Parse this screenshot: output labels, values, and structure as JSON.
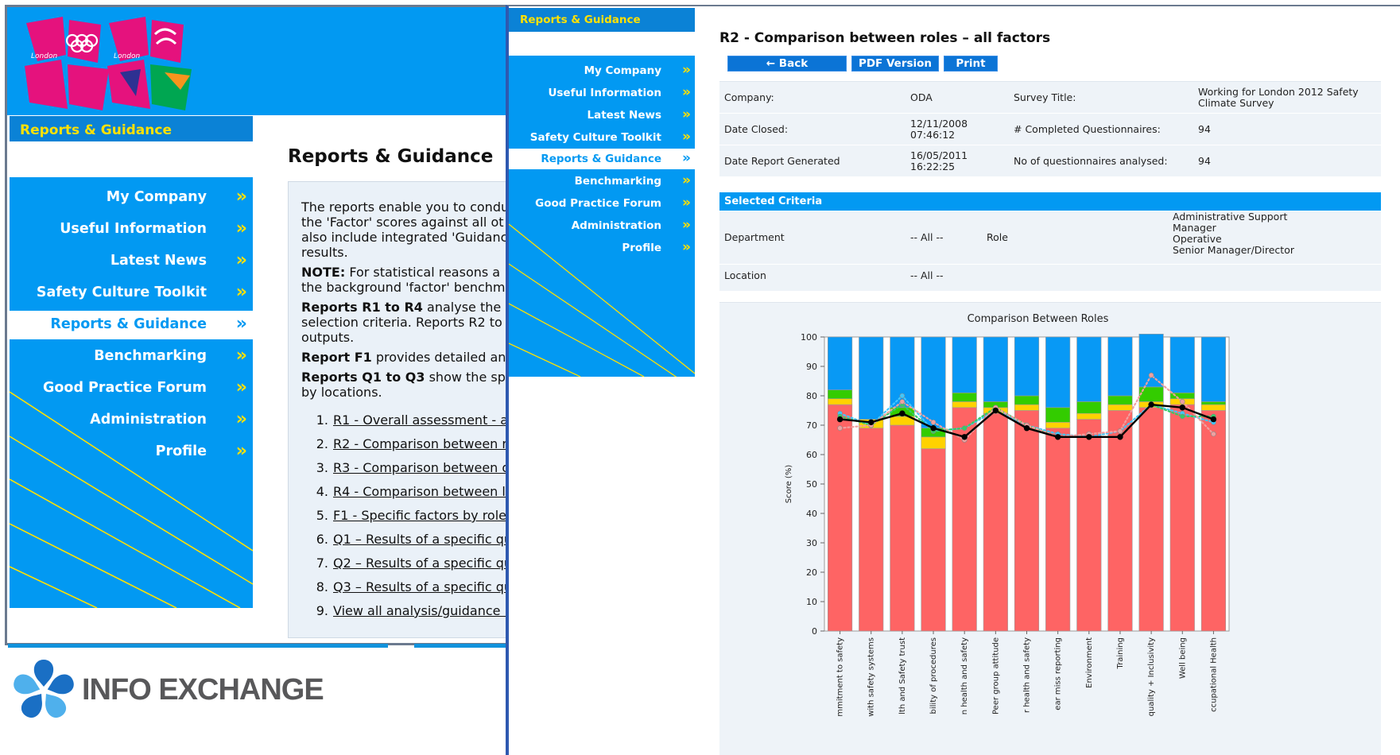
{
  "back_window": {
    "header_label": "Reports & Guidance",
    "nav": [
      {
        "label": "My Company",
        "active": false
      },
      {
        "label": "Useful Information",
        "active": false
      },
      {
        "label": "Latest News",
        "active": false
      },
      {
        "label": "Safety Culture Toolkit",
        "active": false
      },
      {
        "label": "Reports & Guidance",
        "active": true
      },
      {
        "label": "Benchmarking",
        "active": false
      },
      {
        "label": "Good Practice Forum",
        "active": false
      },
      {
        "label": "Administration",
        "active": false
      },
      {
        "label": "Profile",
        "active": false
      }
    ],
    "chevron": "»",
    "page_title": "Reports & Guidance",
    "paragraphs": [
      [
        "The reports enable you to condu",
        "the 'Factor' scores against all ot",
        "also include integrated 'Guidanc",
        "results."
      ],
      [
        "NOTE:",
        " For statistical reasons a",
        "the background 'factor' benchm"
      ],
      [
        "Reports R1 to R4",
        " analyse the",
        "selection criteria. Reports R2 to",
        "outputs."
      ],
      [
        "Report F1",
        " provides detailed an"
      ],
      [
        "Reports Q1 to Q3",
        " show the sp",
        "by locations."
      ]
    ],
    "reports_list": [
      {
        "num": "1.",
        "label": "R1 - Overall assessment - a"
      },
      {
        "num": "2.",
        "label": "R2 - Comparison between r"
      },
      {
        "num": "3.",
        "label": "R3 - Comparison between d"
      },
      {
        "num": "4.",
        "label": "R4 - Comparison between lo"
      },
      {
        "num": "5.",
        "label": "F1 - Specific factors by roles"
      },
      {
        "num": "6.",
        "label": "Q1 – Results of a specific qu"
      },
      {
        "num": "7.",
        "label": "Q2 – Results of a specific qu"
      },
      {
        "num": "8.",
        "label": "Q3 – Results of a specific qu"
      },
      {
        "num": "9.",
        "label": "View all analysis/guidance n"
      }
    ],
    "logo_small_text": "London"
  },
  "footer_logo": {
    "text": "INFO EXCHANGE",
    "colors": {
      "primary": "#1a6fc4",
      "light": "#4fb0ec"
    }
  },
  "front_window": {
    "header_label": "Reports & Guidance",
    "nav": [
      {
        "label": "My Company",
        "active": false
      },
      {
        "label": "Useful Information",
        "active": false
      },
      {
        "label": "Latest News",
        "active": false
      },
      {
        "label": "Safety Culture Toolkit",
        "active": false
      },
      {
        "label": "Reports & Guidance",
        "active": true
      },
      {
        "label": "Benchmarking",
        "active": false
      },
      {
        "label": "Good Practice Forum",
        "active": false
      },
      {
        "label": "Administration",
        "active": false
      },
      {
        "label": "Profile",
        "active": false
      }
    ],
    "chevron": "»",
    "page_title": "R2 - Comparison between roles – all factors",
    "buttons": {
      "back": "← Back",
      "pdf": "PDF Version",
      "print": "Print"
    },
    "info": {
      "company_label": "Company:",
      "company_value": "ODA",
      "survey_title_label": "Survey Title:",
      "survey_title_value_1": "Working for London 2012 Safety",
      "survey_title_value_2": "Climate Survey",
      "date_closed_label": "Date Closed:",
      "date_closed_value_1": "12/11/2008",
      "date_closed_value_2": "07:46:12",
      "completed_label": "# Completed Questionnaires:",
      "completed_value": "94",
      "generated_label": "Date Report Generated",
      "generated_value_1": "16/05/2011",
      "generated_value_2": "16:22:25",
      "analysed_label": "No of questionnaires analysed:",
      "analysed_value": "94"
    },
    "criteria": {
      "heading": "Selected Criteria",
      "department_label": "Department",
      "department_value": "-- All --",
      "role_label": "Role",
      "roles": [
        "Administrative Support",
        "Manager",
        "Operative",
        "Senior Manager/Director"
      ],
      "location_label": "Location",
      "location_value": "-- All --"
    }
  },
  "chart_data": {
    "type": "bar",
    "title": "Comparison Between Roles",
    "ylabel": "Score (%)",
    "xlabel": "",
    "ylim": [
      0,
      100
    ],
    "yticks": [
      0,
      10,
      20,
      30,
      40,
      50,
      60,
      70,
      80,
      90,
      100
    ],
    "grid": false,
    "categories": [
      "mmitment to safety",
      "with safety systems",
      "lth and Safety trust",
      "bility of procedures",
      "n health and safety",
      "Peer group attitude",
      "r health and safety",
      "ear miss reporting",
      "Environment",
      "Training",
      "quality + Inclusivity",
      "Well being",
      "ccupational Health"
    ],
    "stacked_series": [
      {
        "color": "#fe6464",
        "values": [
          77,
          69,
          70,
          62,
          76,
          74,
          75,
          69,
          72,
          75,
          76,
          77,
          75
        ]
      },
      {
        "color": "#ffd200",
        "values": [
          2,
          3,
          3,
          4,
          2,
          2,
          2,
          2,
          2,
          2,
          2,
          2,
          2
        ]
      },
      {
        "color": "#33cc00",
        "values": [
          3,
          0,
          3,
          3,
          3,
          2,
          3,
          5,
          4,
          3,
          5,
          2,
          1
        ]
      },
      {
        "color": "#0899f5",
        "values": [
          18,
          28,
          24,
          31,
          19,
          22,
          20,
          24,
          22,
          20,
          18,
          19,
          22
        ]
      }
    ],
    "line_series": [
      {
        "color": "#000000",
        "values": [
          72,
          71,
          74,
          69,
          66,
          75,
          69,
          66,
          66,
          66,
          77,
          76,
          72
        ]
      },
      {
        "color": "#40c8ff",
        "values": [
          74,
          70,
          80,
          68,
          69,
          75,
          70,
          67,
          66,
          68,
          77,
          74,
          71
        ]
      },
      {
        "color": "#33cc66",
        "values": [
          73,
          70,
          77,
          68,
          69,
          76,
          70,
          66,
          66,
          66,
          77,
          73,
          73
        ]
      },
      {
        "color": "#f0a0a0",
        "values": [
          69,
          70,
          78,
          71,
          65,
          76,
          70,
          66,
          67,
          68,
          87,
          78,
          67
        ]
      }
    ]
  }
}
